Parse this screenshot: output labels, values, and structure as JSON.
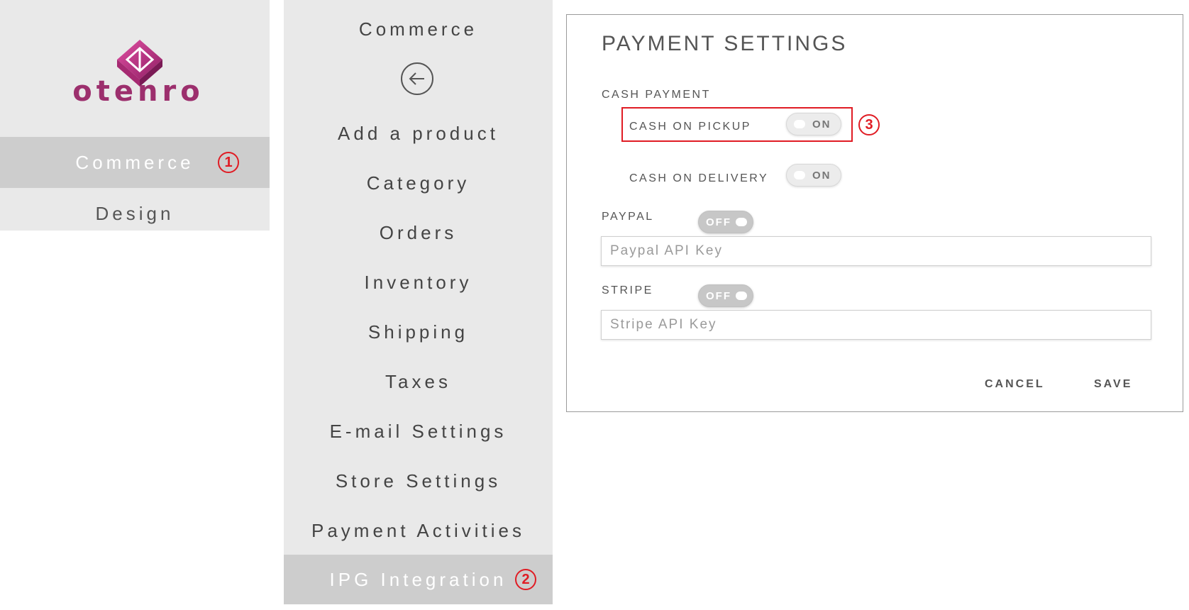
{
  "brand": {
    "logo_text": "otenro",
    "logo_color": "#9c2f6d"
  },
  "sidebar": {
    "items": [
      {
        "label": "Commerce",
        "active": true,
        "badge": "1"
      },
      {
        "label": "Design",
        "active": false
      }
    ]
  },
  "submenu": {
    "title": "Commerce",
    "items": [
      {
        "label": "Add a product"
      },
      {
        "label": "Category"
      },
      {
        "label": "Orders"
      },
      {
        "label": "Inventory"
      },
      {
        "label": "Shipping"
      },
      {
        "label": "Taxes"
      },
      {
        "label": "E-mail Settings"
      },
      {
        "label": "Store Settings"
      },
      {
        "label": "Payment Activities"
      },
      {
        "label": "IPG Integration",
        "active": true,
        "badge": "2"
      }
    ]
  },
  "payment": {
    "title": "PAYMENT SETTINGS",
    "cash_section": "CASH PAYMENT",
    "cash_on_pickup": {
      "label": "CASH ON PICKUP",
      "state": "ON",
      "badge": "3"
    },
    "cash_on_delivery": {
      "label": "CASH ON DELIVERY",
      "state": "ON"
    },
    "paypal": {
      "label": "PAYPAL",
      "state": "OFF",
      "placeholder": "Paypal API Key"
    },
    "stripe": {
      "label": "STRIPE",
      "state": "OFF",
      "placeholder": "Stripe API Key"
    },
    "cancel_label": "CANCEL",
    "save_label": "SAVE"
  },
  "colors": {
    "accent_red": "#e01c24",
    "menu_bg": "#e9e9e9",
    "active_bg": "#cdcdcd"
  },
  "icons": {
    "back": "back-arrow-icon"
  }
}
